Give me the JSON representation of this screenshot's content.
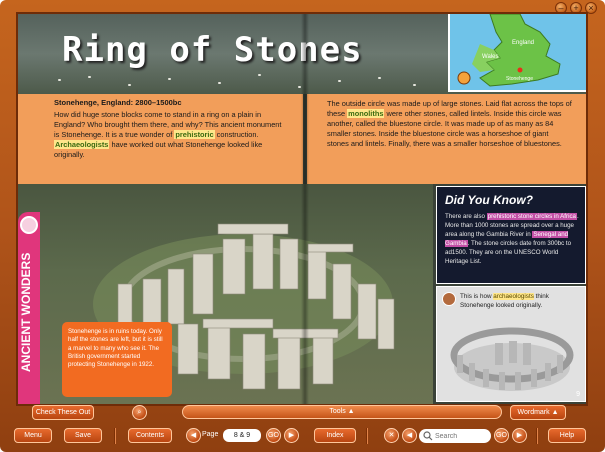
{
  "book": {
    "title": "Ring of Stones",
    "map_labels": {
      "wales": "Wales",
      "england": "England",
      "stonehenge": "Stonehenge"
    },
    "left": {
      "heading": "Stonehenge, England:  2800–1500bc",
      "p1": "How did huge stone blocks come to stand in a ring on a plain in England? Who brought them there, and why? This ancient monument is Stonehenge. It is a true wonder of ",
      "hl1": "prehistoric",
      "p2": " construction. ",
      "hl2": "Archaeologists",
      "p3": " have worked out what Stonehenge looked like originally."
    },
    "right": {
      "p1": "The outside circle was made up of large stones. Laid flat across the tops of these ",
      "hl1": "monoliths",
      "p2": " were other stones, called lintels. Inside this circle was another, called the bluestone circle. It was made up of as many as 84 smaller stones. Inside the bluestone circle was a horseshoe of giant stones and lintels. Finally, there was a smaller horseshoe of bluestones."
    },
    "side_tab_label": "ANCIENT WONDERS",
    "callout_text": "Stonehenge is in ruins today. Only half the stones are left, but it is still a marvel to many who see it. The British government started protecting Stonehenge in 1922.",
    "did_you_know": {
      "title": "Did You Know?",
      "t1": "There are also ",
      "hl1": "prehistoric stone circles in Africa",
      "t2": ". More than 1000 stones are spread over a huge area along the Gambia River in ",
      "hl2": "Senegal and Gambia",
      "t3": ". The stone circles date from 300bc to ad1500. They are on the UNESCO World Heritage List."
    },
    "reconstruction": {
      "t1": "This is how ",
      "hl": "archaeologists",
      "t2": " think Stonehenge looked originally."
    },
    "page_number": "9"
  },
  "toolbar_top": {
    "check_label": "Check These Out",
    "zoom_icon": "magnifier-icon",
    "tools_label": "Tools ▲",
    "wordmark_label": "Wordmark ▲"
  },
  "toolbar_bottom": {
    "menu": "Menu",
    "save": "Save",
    "contents": "Contents",
    "page_label": "Page",
    "page_value": "8 & 9",
    "go": "GO",
    "index": "Index",
    "search_placeholder": "Search",
    "help": "Help"
  },
  "window": {
    "minimize": "–",
    "close": "×"
  }
}
